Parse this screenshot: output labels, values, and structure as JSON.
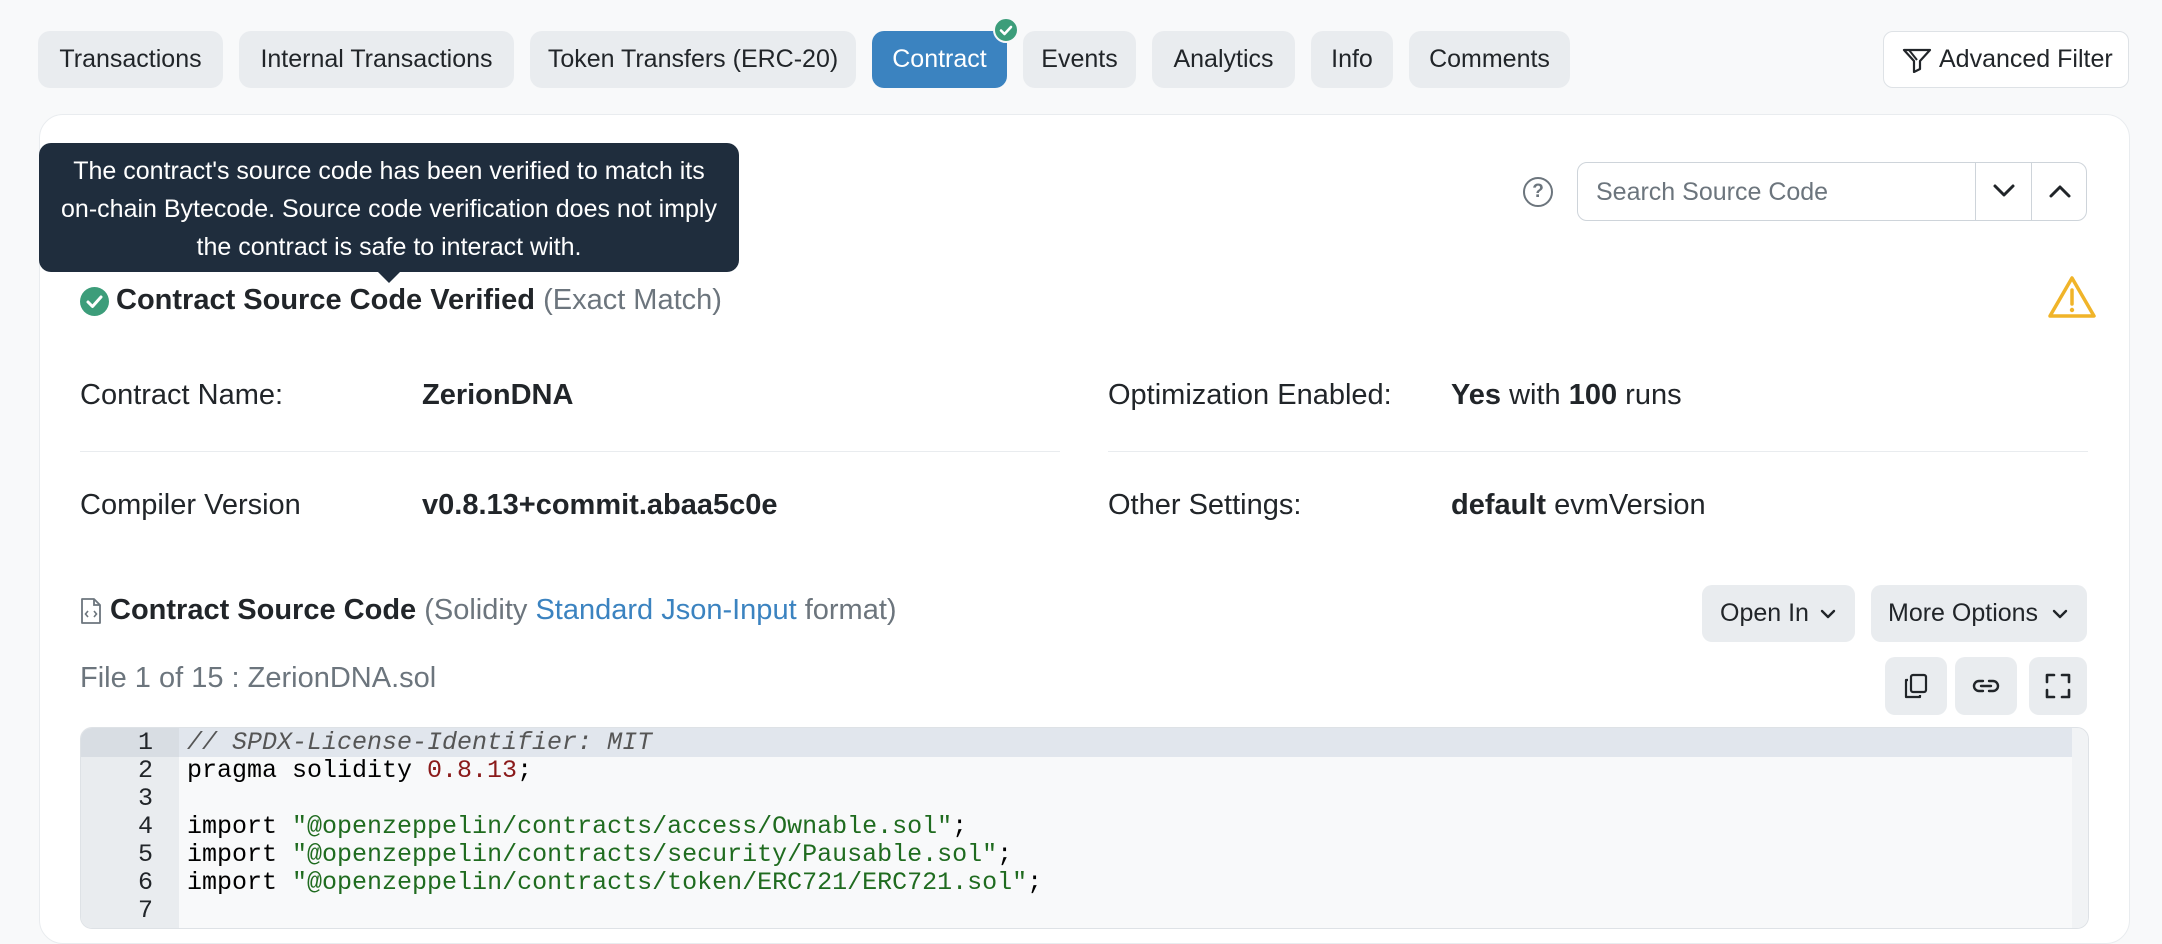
{
  "tabs": [
    {
      "label": "Transactions"
    },
    {
      "label": "Internal Transactions"
    },
    {
      "label": "Token Transfers (ERC-20)"
    },
    {
      "label": "Contract"
    },
    {
      "label": "Events"
    },
    {
      "label": "Analytics"
    },
    {
      "label": "Info"
    },
    {
      "label": "Comments"
    }
  ],
  "advanced_filter_label": "Advanced Filter",
  "tooltip_text": "The contract's source code has been verified to match its on-chain Bytecode. Source code verification does not imply the contract is safe to interact with.",
  "search": {
    "placeholder": "Search Source Code"
  },
  "verified": {
    "title": "Contract Source Code Verified",
    "subtitle": "(Exact Match)"
  },
  "details": {
    "contract_name_label": "Contract Name:",
    "contract_name": "ZerionDNA",
    "compiler_label": "Compiler Version",
    "compiler_value": "v0.8.13+commit.abaa5c0e",
    "optimization_label": "Optimization Enabled:",
    "optimization_yes": "Yes",
    "optimization_with": "with",
    "optimization_runs": "100",
    "optimization_runs_word": "runs",
    "settings_label": "Other Settings:",
    "settings_default": "default",
    "settings_evm": "evmVersion"
  },
  "source": {
    "title": "Contract Source Code",
    "paren_open": "(Solidity",
    "format_link": "Standard Json-Input",
    "paren_close": "format)",
    "open_in_label": "Open In",
    "more_options_label": "More Options",
    "file_info": "File 1 of 15 : ZerionDNA.sol"
  },
  "code": {
    "line_numbers": [
      "1",
      "2",
      "3",
      "4",
      "5",
      "6",
      "7"
    ],
    "line1": "// SPDX-License-Identifier: MIT",
    "line2_kw": "pragma solidity ",
    "line2_num": "0.8.13",
    "line2_end": ";",
    "import_kw": "import ",
    "line4_str": "\"@openzeppelin/contracts/access/Ownable.sol\"",
    "line5_str": "\"@openzeppelin/contracts/security/Pausable.sol\"",
    "line6_str": "\"@openzeppelin/contracts/token/ERC721/ERC721.sol\"",
    "semicolon": ";"
  },
  "colors": {
    "accent": "#3b83c0",
    "verified": "#3c9d7a",
    "tooltip_bg": "#1f2d3d",
    "warning": "#f0b429"
  }
}
